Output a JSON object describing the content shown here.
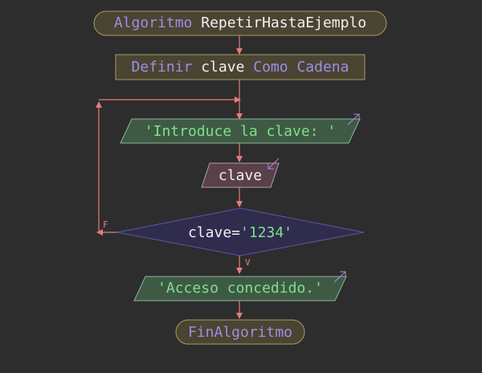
{
  "start": {
    "keyword": "Algoritmo",
    "name": "RepetirHastaEjemplo"
  },
  "define": {
    "kw1": "Definir",
    "var": "clave",
    "kw2": "Como",
    "type": "Cadena"
  },
  "write1": {
    "text": "'Introduce la clave: '"
  },
  "read": {
    "text": "clave"
  },
  "condition": {
    "var": "clave",
    "op": "=",
    "value": "'1234'"
  },
  "false_label": "F",
  "true_label": "V",
  "write2": {
    "text": "'Acceso concedido.'"
  },
  "end": {
    "text": "FinAlgoritmo"
  },
  "colors": {
    "background": "#2d2d2d",
    "arrow": "#e77b7b",
    "keyword": "#9b8fe8",
    "identifier": "#f0f0f0",
    "string": "#7ee08a",
    "terminal_fill": "#4a4432",
    "terminal_stroke": "#a89a64",
    "io_fill": "#3f5a44",
    "io_stroke": "#8fb595",
    "read_fill": "#5a4048",
    "read_stroke": "#b79aa3",
    "decision_fill": "#302c4e",
    "decision_stroke": "#5e56a6"
  }
}
